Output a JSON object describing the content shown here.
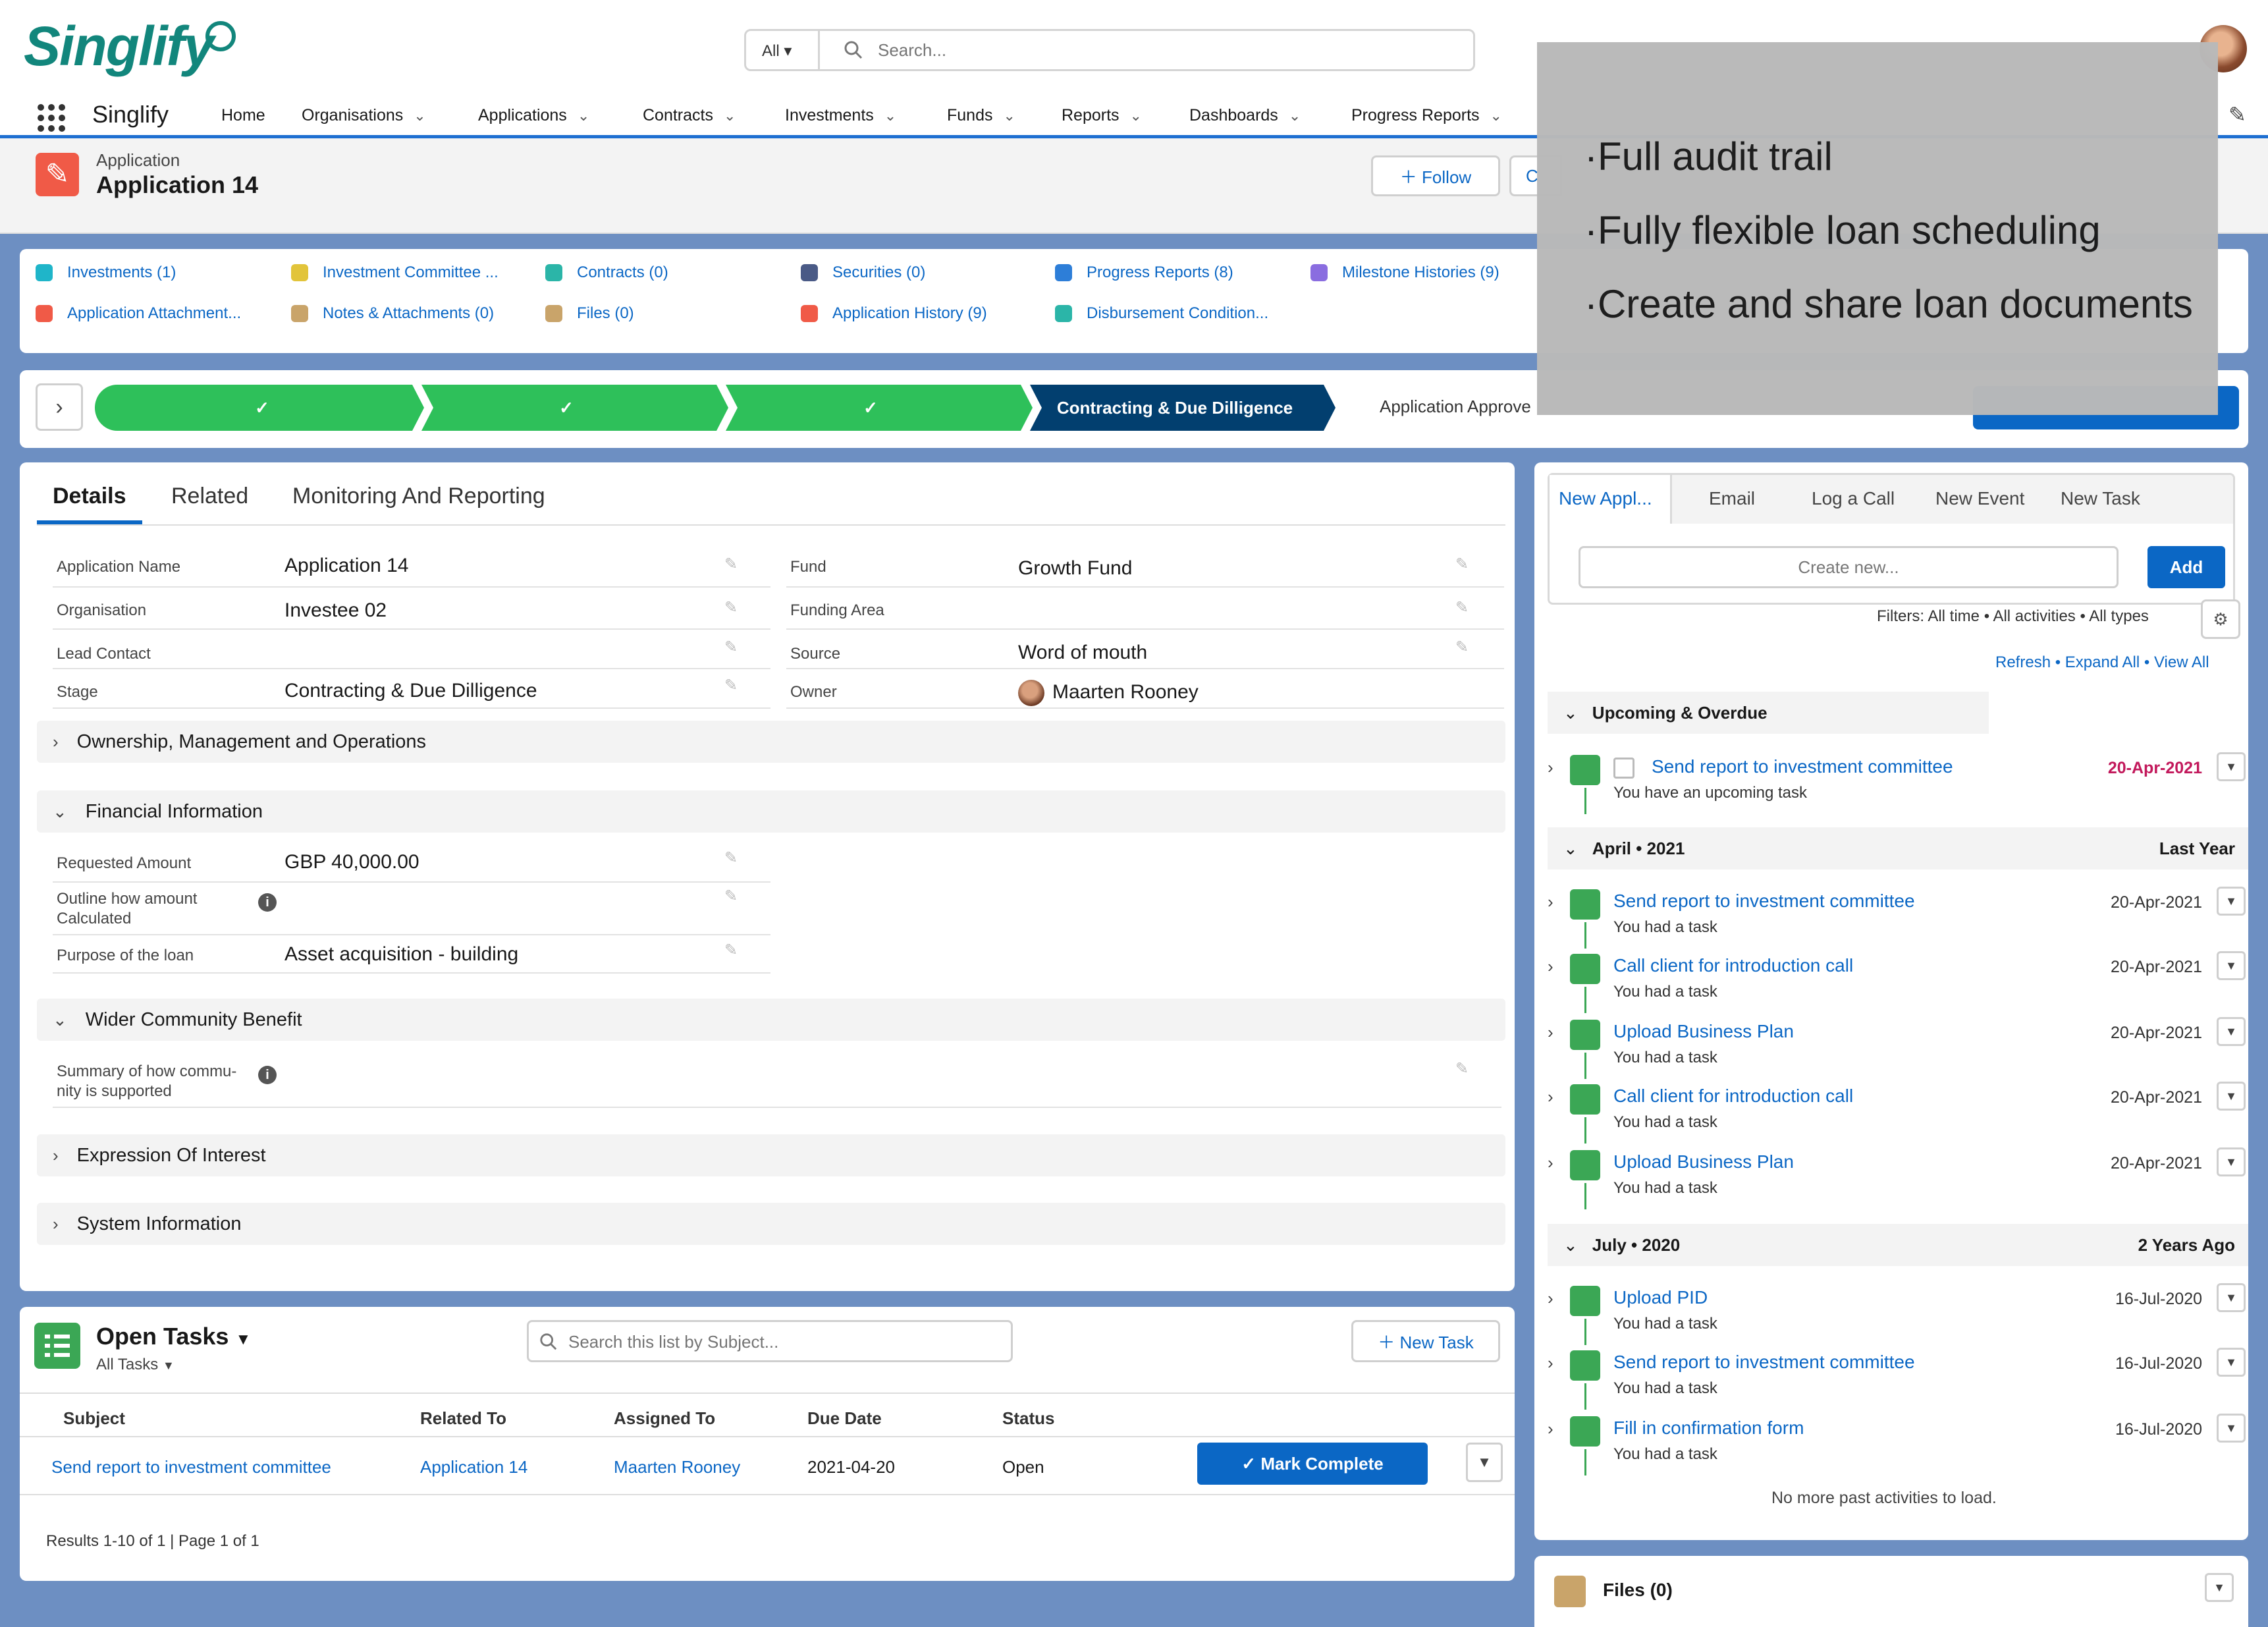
{
  "brand": {
    "name": "Singlify",
    "accent": "#0b67c5",
    "success": "#2ec05a",
    "brand_color": "#12867c"
  },
  "search": {
    "scope": "All",
    "placeholder": "Search..."
  },
  "nav": {
    "app_name": "Singlify",
    "items": [
      {
        "label": "Home",
        "has_menu": false
      },
      {
        "label": "Organisations",
        "has_menu": true
      },
      {
        "label": "Applications",
        "has_menu": true
      },
      {
        "label": "Contracts",
        "has_menu": true
      },
      {
        "label": "Investments",
        "has_menu": true
      },
      {
        "label": "Funds",
        "has_menu": true
      },
      {
        "label": "Reports",
        "has_menu": true
      },
      {
        "label": "Dashboards",
        "has_menu": true
      },
      {
        "label": "Progress Reports",
        "has_menu": true
      }
    ]
  },
  "record": {
    "type": "Application",
    "title": "Application 14",
    "follow_label": "Follow",
    "partial_button": "C"
  },
  "related_links": [
    {
      "label": "Investments (1)",
      "color": "#1fb5c9"
    },
    {
      "label": "Investment Committee ...",
      "color": "#e2c43a"
    },
    {
      "label": "Contracts (0)",
      "color": "#2bb5a8"
    },
    {
      "label": "Securities (0)",
      "color": "#4a5a86"
    },
    {
      "label": "Progress Reports (8)",
      "color": "#2d7ed8"
    },
    {
      "label": "Milestone Histories (9)",
      "color": "#8a6de0"
    },
    {
      "label": "Application Attachment...",
      "color": "#f05a47"
    },
    {
      "label": "Notes & Attachments (0)",
      "color": "#c9a46a"
    },
    {
      "label": "Files (0)",
      "color": "#c9a46a"
    },
    {
      "label": "Application History (9)",
      "color": "#f05a47"
    },
    {
      "label": "Disbursement Condition...",
      "color": "#2bb5a8"
    }
  ],
  "path": {
    "completed_marks": [
      "✓",
      "✓",
      "✓"
    ],
    "current_stage": "Contracting & Due Dilligence",
    "next_stage": "Application Approve"
  },
  "details": {
    "tabs": [
      "Details",
      "Related",
      "Monitoring And Reporting"
    ],
    "fields_left": [
      {
        "label": "Application Name",
        "value": "Application 14",
        "link": false
      },
      {
        "label": "Organisation",
        "value": "Investee 02",
        "link": true
      },
      {
        "label": "Lead Contact",
        "value": "",
        "link": false
      },
      {
        "label": "Stage",
        "value": "Contracting & Due Dilligence",
        "link": false
      }
    ],
    "fields_right": [
      {
        "label": "Fund",
        "value": "Growth Fund",
        "link": true
      },
      {
        "label": "Funding Area",
        "value": "",
        "link": false
      },
      {
        "label": "Source",
        "value": "Word of mouth",
        "link": false
      },
      {
        "label": "Owner",
        "value": "Maarten Rooney",
        "link": true
      }
    ],
    "sections": {
      "ownership": "Ownership, Management and Operations",
      "financial": "Financial Information",
      "community": "Wider Community Benefit",
      "interest": "Expression Of Interest",
      "system": "System Information"
    },
    "financial_fields": [
      {
        "label": "Requested Amount",
        "value": "GBP 40,000.00"
      },
      {
        "label": "Outline how amount Calculated",
        "value": ""
      },
      {
        "label": "Purpose of the loan",
        "value": "Asset acquisition - building"
      }
    ],
    "community_fields": [
      {
        "label": "Summary of how commu- nity is supported",
        "value": ""
      }
    ]
  },
  "tasks": {
    "title": "Open Tasks",
    "view": "All Tasks",
    "search_placeholder": "Search this list by Subject...",
    "new_task_label": "New Task",
    "columns": [
      "Subject",
      "Related To",
      "Assigned To",
      "Due Date",
      "Status"
    ],
    "rows": [
      {
        "subject": "Send report to investment committee",
        "related_to": "Application 14",
        "assigned_to": "Maarten Rooney",
        "due_date": "2021-04-20",
        "status": "Open"
      }
    ],
    "mark_complete_label": "Mark Complete",
    "footer": "Results 1-10 of 1 | Page 1 of 1"
  },
  "activity": {
    "tabs": [
      "New Appl...",
      "Email",
      "Log a Call",
      "New Event",
      "New Task"
    ],
    "create_placeholder": "Create new...",
    "add_label": "Add",
    "filters": "Filters: All time • All activities • All types",
    "links": {
      "refresh": "Refresh",
      "expand": "Expand All",
      "view_all": "View All"
    },
    "upcoming": {
      "title": "Upcoming & Overdue",
      "items": [
        {
          "title": "Send report to investment committee",
          "sub": "You have an upcoming task",
          "date": "20-Apr-2021"
        }
      ]
    },
    "groups": [
      {
        "title": "April • 2021",
        "right": "Last Year",
        "items": [
          {
            "title": "Send report to investment committee",
            "sub": "You had a task",
            "date": "20-Apr-2021"
          },
          {
            "title": "Call client for introduction call",
            "sub": "You had a task",
            "date": "20-Apr-2021"
          },
          {
            "title": "Upload Business Plan",
            "sub": "You had a task",
            "date": "20-Apr-2021"
          },
          {
            "title": "Call client for introduction call",
            "sub": "You had a task",
            "date": "20-Apr-2021"
          },
          {
            "title": "Upload Business Plan",
            "sub": "You had a task",
            "date": "20-Apr-2021"
          }
        ]
      },
      {
        "title": "July • 2020",
        "right": "2 Years Ago",
        "items": [
          {
            "title": "Upload PID",
            "sub": "You had a task",
            "date": "16-Jul-2020"
          },
          {
            "title": "Send report to investment committee",
            "sub": "You had a task",
            "date": "16-Jul-2020"
          },
          {
            "title": "Fill in confirmation form",
            "sub": "You had a task",
            "date": "16-Jul-2020"
          }
        ]
      }
    ],
    "no_more": "No more past activities to load."
  },
  "files": {
    "label": "Files (0)"
  },
  "overlay": {
    "lines": [
      "·Full audit trail",
      "·Fully flexible loan scheduling",
      "·Create and share loan documents"
    ]
  }
}
